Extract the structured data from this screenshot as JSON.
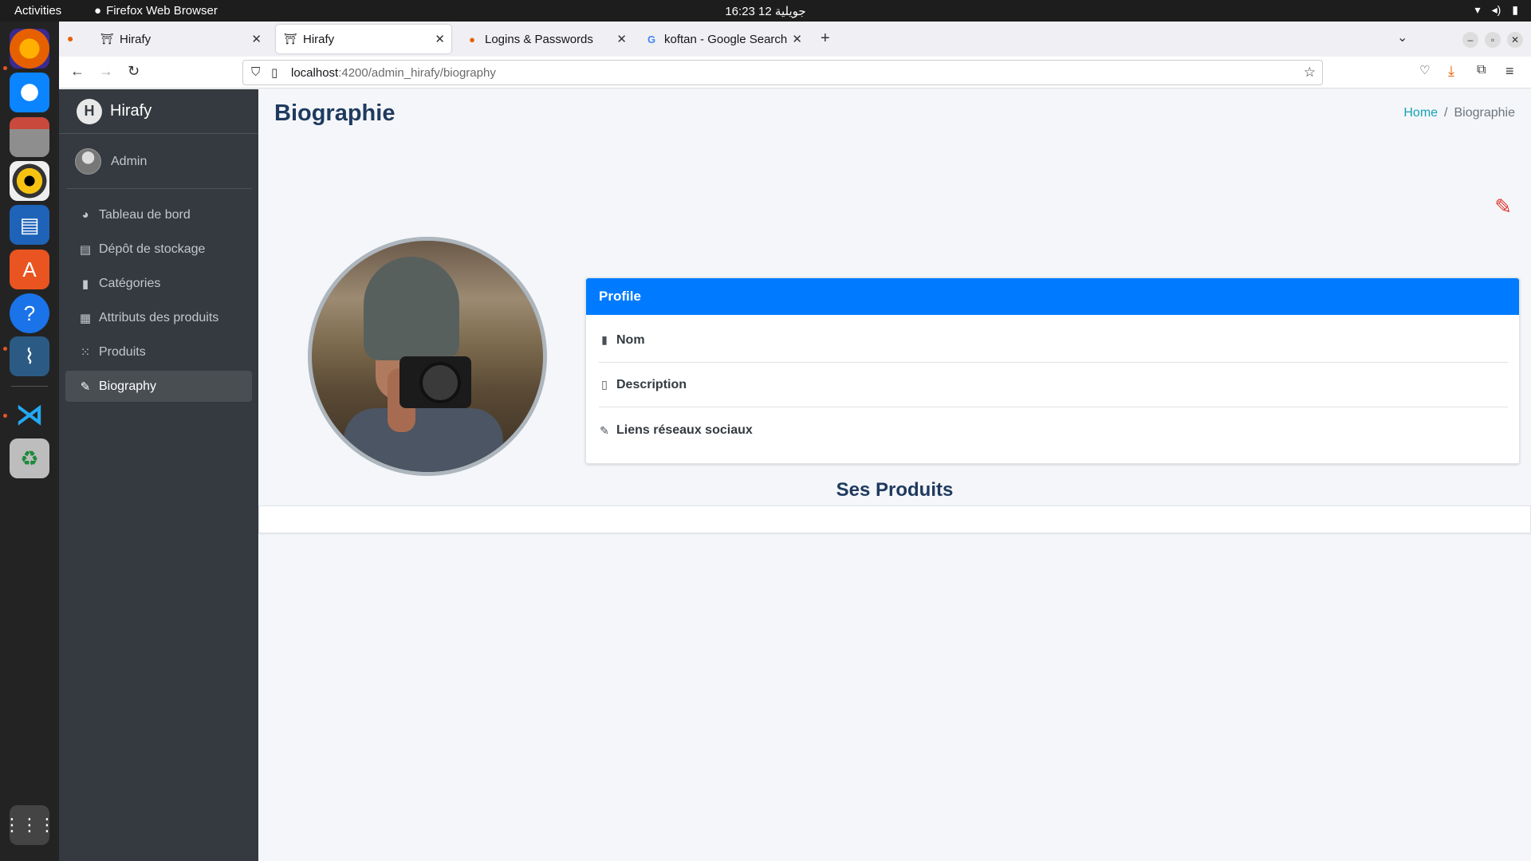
{
  "system": {
    "activities": "Activities",
    "app_name": "Firefox Web Browser",
    "clock": "16:23  12 جويلية"
  },
  "browser": {
    "tabs": [
      {
        "label": "Hirafy",
        "active": false
      },
      {
        "label": "Hirafy",
        "active": true
      },
      {
        "label": "Logins & Passwords",
        "active": false
      },
      {
        "label": "koftan - Google Search",
        "active": false
      }
    ],
    "url_host": "localhost",
    "url_path": ":4200/admin_hirafy/biography"
  },
  "sidebar": {
    "brand": "Hirafy",
    "brand_logo": "H",
    "user": "Admin",
    "items": [
      {
        "label": "Tableau de bord",
        "icon": "pie-chart-icon"
      },
      {
        "label": "Dépôt de stockage",
        "icon": "archive-icon"
      },
      {
        "label": "Catégories",
        "icon": "clipboard-icon"
      },
      {
        "label": "Attributs des produits",
        "icon": "table-icon"
      },
      {
        "label": "Produits",
        "icon": "grid-icon"
      },
      {
        "label": "Biography",
        "icon": "edit-icon"
      }
    ],
    "active_index": 5
  },
  "content": {
    "title": "Biographie",
    "breadcrumb_home": "Home",
    "breadcrumb_sep": "/",
    "breadcrumb_current": "Biographie",
    "profile_header": "Profile",
    "rows": [
      {
        "label": "Nom",
        "icon": "book-icon"
      },
      {
        "label": "Description",
        "icon": "file-icon"
      },
      {
        "label": "Liens réseaux sociaux",
        "icon": "pencil-icon"
      }
    ],
    "products_title": "Ses Produits"
  },
  "colors": {
    "sidebar_bg": "#343a40",
    "card_header": "#007bff",
    "edit_icon": "#e0352b",
    "breadcrumb_link": "#17a2b8",
    "title": "#1f3a5f"
  }
}
